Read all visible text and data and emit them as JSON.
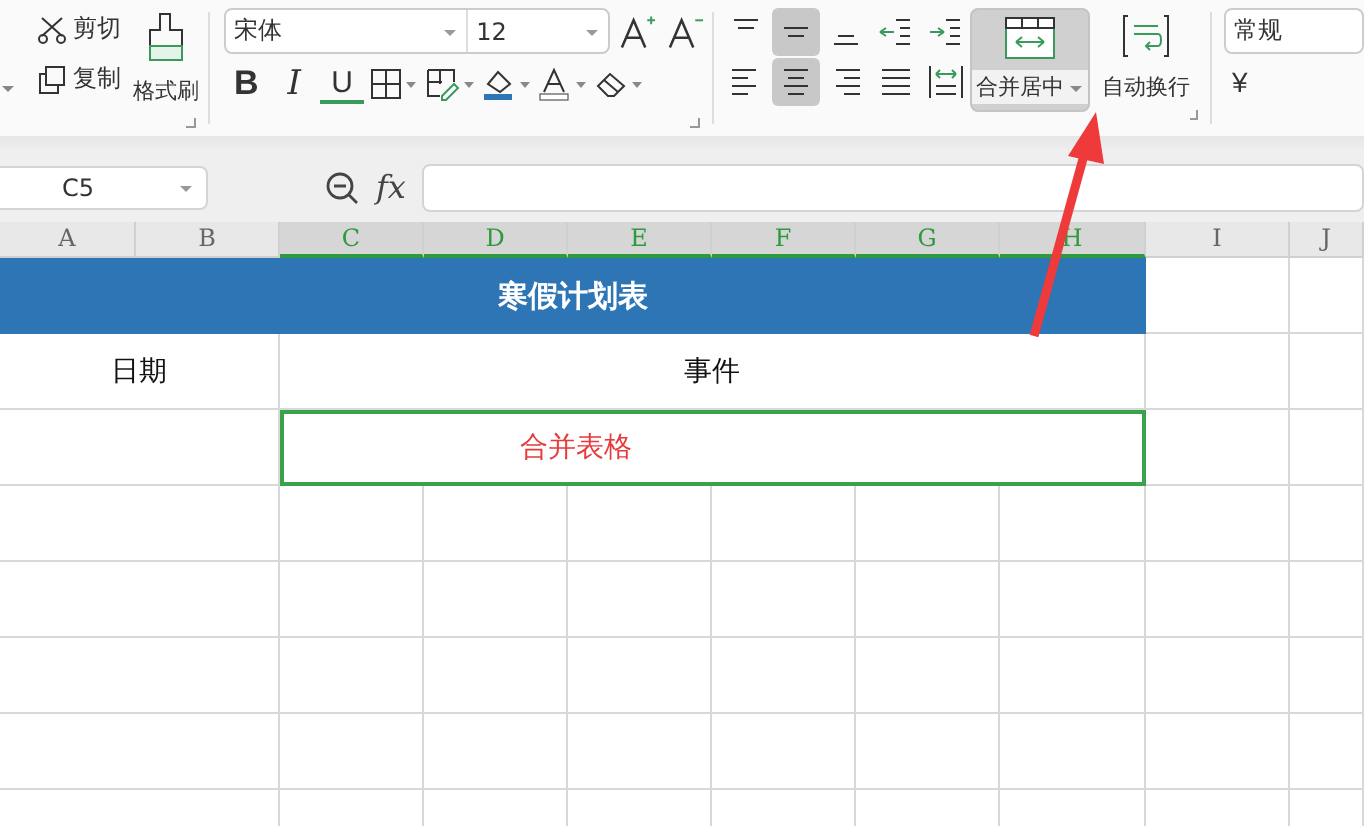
{
  "ribbon": {
    "clipboard": [
      {
        "kind": "cut",
        "label": "剪切"
      },
      {
        "kind": "copy",
        "label": "复制"
      }
    ],
    "format_painter": {
      "label": "格式刷"
    },
    "font": {
      "name": "宋体",
      "size": "12"
    },
    "font_buttons": [
      {
        "kind": "bold",
        "label": "B"
      },
      {
        "kind": "italic",
        "label": "I"
      },
      {
        "kind": "underline",
        "label": "U"
      },
      {
        "kind": "border"
      },
      {
        "kind": "cellstyle"
      },
      {
        "kind": "fill"
      },
      {
        "kind": "fontcolor"
      },
      {
        "kind": "clear"
      }
    ],
    "align_top": [
      {
        "kind": "top",
        "selected": false
      },
      {
        "kind": "middle",
        "selected": true
      },
      {
        "kind": "bottom",
        "selected": false
      },
      {
        "kind": "outdent",
        "selected": false
      },
      {
        "kind": "indent",
        "selected": false
      }
    ],
    "align_bottom": [
      {
        "kind": "left",
        "selected": false
      },
      {
        "kind": "center",
        "selected": true
      },
      {
        "kind": "right",
        "selected": false
      },
      {
        "kind": "justify",
        "selected": false
      },
      {
        "kind": "distribute",
        "selected": false
      }
    ],
    "merge_button": {
      "label": "合并居中",
      "selected": true
    },
    "wrap_button": {
      "label": "自动换行"
    },
    "number_format": "常规",
    "currency": "¥"
  },
  "formula_bar": {
    "name_box": "C5",
    "fx": "fx"
  },
  "sheet": {
    "columns": [
      {
        "label": "A",
        "selected": false
      },
      {
        "label": "B",
        "selected": false
      },
      {
        "label": "C",
        "selected": true
      },
      {
        "label": "D",
        "selected": true
      },
      {
        "label": "E",
        "selected": true
      },
      {
        "label": "F",
        "selected": true
      },
      {
        "label": "G",
        "selected": true
      },
      {
        "label": "H",
        "selected": true
      },
      {
        "label": "I",
        "selected": false
      },
      {
        "label": "J",
        "selected": false
      }
    ],
    "title": "寒假计划表",
    "headers": [
      "日期",
      "事件"
    ],
    "merged_cell": {
      "text": "合并表格",
      "selected": true
    }
  }
}
